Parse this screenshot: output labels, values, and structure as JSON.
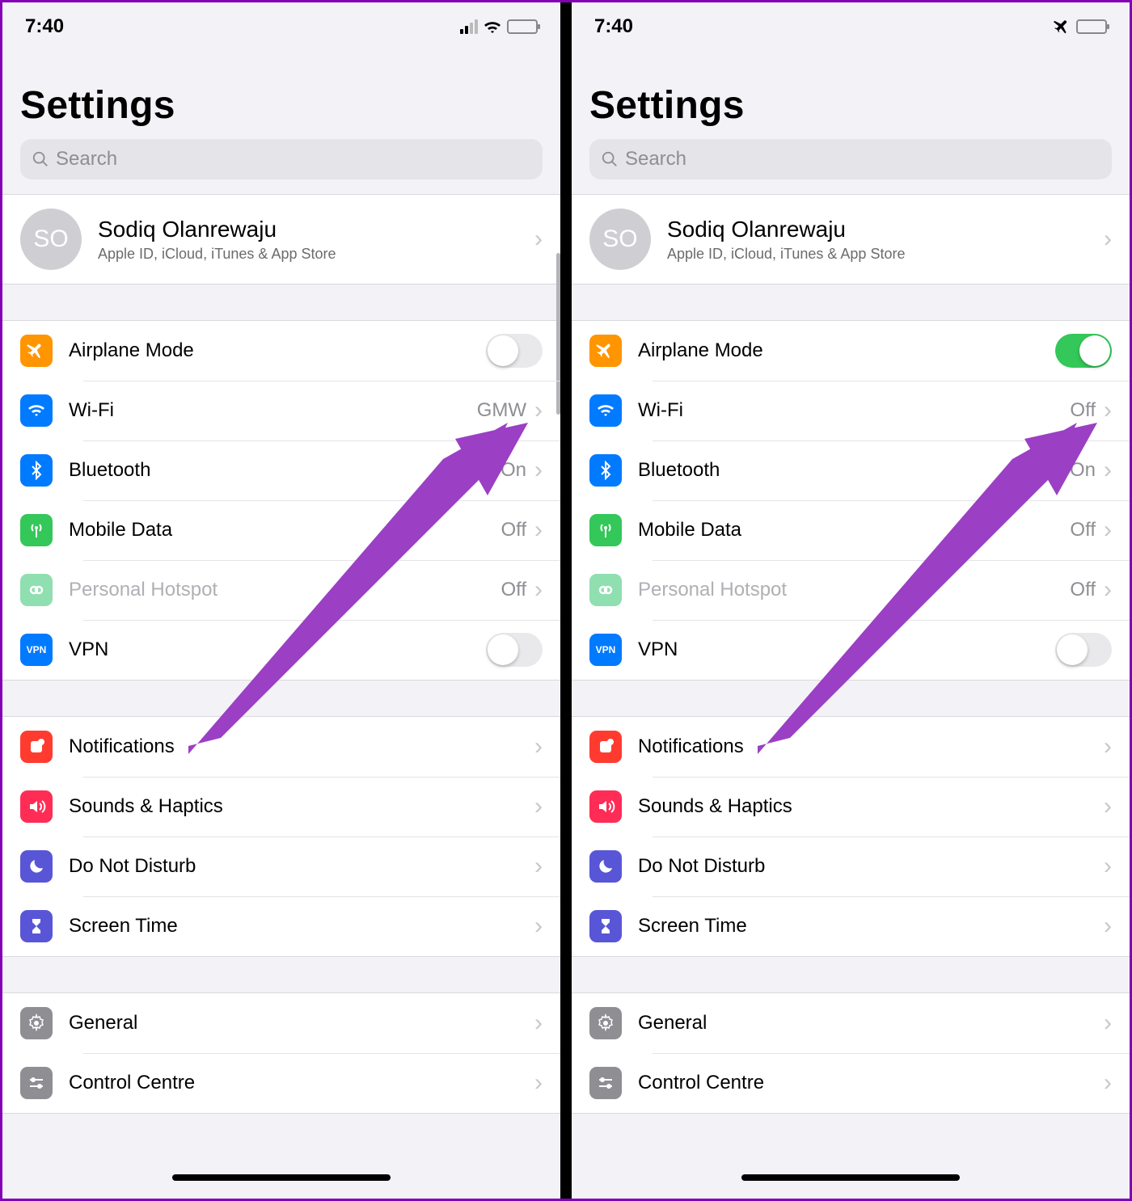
{
  "left": {
    "time": "7:40",
    "status_icons": [
      "signal",
      "wifi",
      "battery"
    ],
    "title": "Settings",
    "search_placeholder": "Search",
    "profile": {
      "initials": "SO",
      "name": "Sodiq Olanrewaju",
      "sub": "Apple ID, iCloud, iTunes & App Store"
    },
    "net": {
      "airplane": {
        "label": "Airplane Mode",
        "on": false
      },
      "wifi": {
        "label": "Wi-Fi",
        "value": "GMW"
      },
      "bt": {
        "label": "Bluetooth",
        "value": "On"
      },
      "mobile": {
        "label": "Mobile Data",
        "value": "Off"
      },
      "hotspot": {
        "label": "Personal Hotspot",
        "value": "Off",
        "disabled": true
      },
      "vpn": {
        "label": "VPN",
        "on": false
      }
    },
    "sys": {
      "notif": {
        "label": "Notifications"
      },
      "sounds": {
        "label": "Sounds & Haptics"
      },
      "dnd": {
        "label": "Do Not Disturb"
      },
      "screen": {
        "label": "Screen Time"
      }
    },
    "gen": {
      "general": {
        "label": "General"
      },
      "control": {
        "label": "Control Centre"
      }
    }
  },
  "right": {
    "time": "7:40",
    "status_icons": [
      "airplane",
      "battery"
    ],
    "title": "Settings",
    "search_placeholder": "Search",
    "profile": {
      "initials": "SO",
      "name": "Sodiq Olanrewaju",
      "sub": "Apple ID, iCloud, iTunes & App Store"
    },
    "net": {
      "airplane": {
        "label": "Airplane Mode",
        "on": true
      },
      "wifi": {
        "label": "Wi-Fi",
        "value": "Off"
      },
      "bt": {
        "label": "Bluetooth",
        "value": "On"
      },
      "mobile": {
        "label": "Mobile Data",
        "value": "Off"
      },
      "hotspot": {
        "label": "Personal Hotspot",
        "value": "Off",
        "disabled": true
      },
      "vpn": {
        "label": "VPN",
        "on": false
      }
    },
    "sys": {
      "notif": {
        "label": "Notifications"
      },
      "sounds": {
        "label": "Sounds & Haptics"
      },
      "dnd": {
        "label": "Do Not Disturb"
      },
      "screen": {
        "label": "Screen Time"
      }
    },
    "gen": {
      "general": {
        "label": "General"
      },
      "control": {
        "label": "Control Centre"
      }
    }
  },
  "annotation": {
    "arrow_color": "#9b3fc4"
  }
}
